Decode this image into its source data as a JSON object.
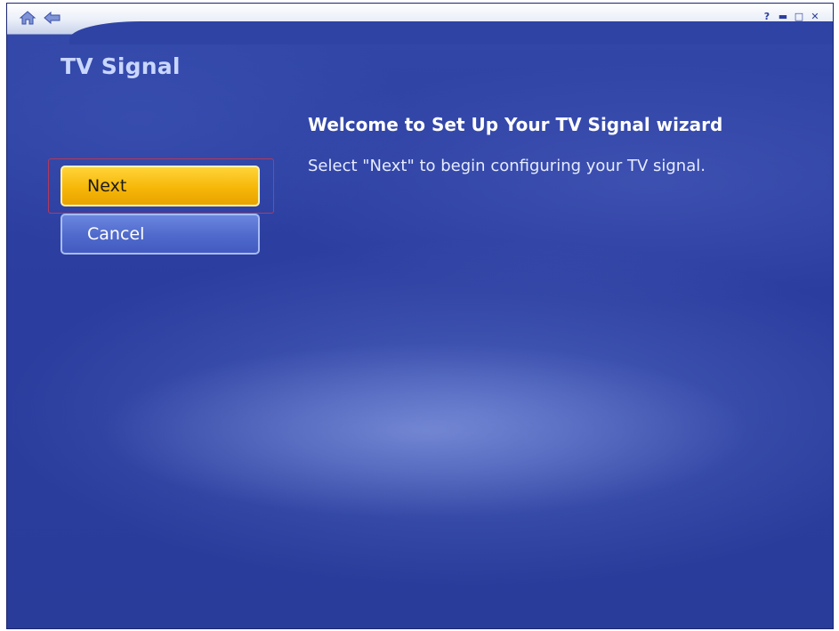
{
  "window": {
    "icons": {
      "home": "home-icon",
      "back": "back-arrow-icon",
      "help": "help-icon",
      "minimize": "minimize-icon",
      "maximize": "maximize-icon",
      "close": "close-icon"
    },
    "controls": {
      "help": "?",
      "minimize": "▬",
      "maximize": "□",
      "close": "✕"
    }
  },
  "page": {
    "title": "TV Signal",
    "heading": "Welcome to Set Up Your TV Signal wizard",
    "instruction": "Select \"Next\" to begin configuring your TV signal."
  },
  "buttons": {
    "next": "Next",
    "cancel": "Cancel"
  },
  "colors": {
    "background": "#2a3d9c",
    "next_button": "#f6b708",
    "cancel_button": "#4f69cc",
    "title_text": "#c9d6ff",
    "focus_ring": "#b23a5c"
  }
}
